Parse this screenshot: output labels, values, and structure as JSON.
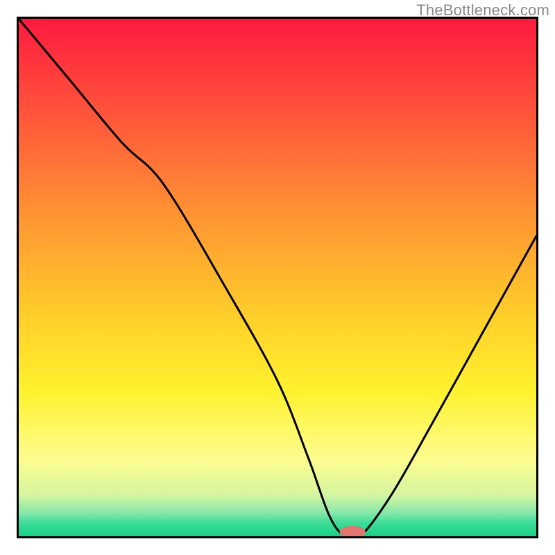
{
  "watermark": "TheBottleneck.com",
  "colors": {
    "border": "#000000",
    "curve": "#000000",
    "marker_fill": "#e2766f",
    "gradient_stops": [
      {
        "offset": 0.0,
        "color": "#ff1a3f"
      },
      {
        "offset": 0.2,
        "color": "#ff5a3a"
      },
      {
        "offset": 0.4,
        "color": "#ff9a32"
      },
      {
        "offset": 0.58,
        "color": "#ffd02a"
      },
      {
        "offset": 0.72,
        "color": "#fff22e"
      },
      {
        "offset": 0.85,
        "color": "#fdfd8f"
      },
      {
        "offset": 0.92,
        "color": "#d6f5a0"
      },
      {
        "offset": 0.955,
        "color": "#86e8aa"
      },
      {
        "offset": 0.975,
        "color": "#3bdc98"
      },
      {
        "offset": 1.0,
        "color": "#19d083"
      }
    ]
  },
  "chart_data": {
    "type": "line",
    "title": "",
    "xlabel": "",
    "ylabel": "",
    "xlim": [
      0,
      100
    ],
    "ylim": [
      0,
      100
    ],
    "grid": false,
    "legend": false,
    "annotations": [
      "TheBottleneck.com"
    ],
    "series": [
      {
        "name": "curve",
        "x": [
          0,
          10,
          20,
          28,
          40,
          50,
          56,
          60,
          63,
          66,
          72,
          80,
          90,
          100
        ],
        "values": [
          100,
          88,
          76,
          68,
          48,
          30,
          15,
          4,
          0,
          0,
          8,
          22,
          40,
          58
        ]
      }
    ],
    "marker": {
      "x": 64.5,
      "y": 0,
      "rx": 2.5,
      "ry": 1.2
    }
  }
}
